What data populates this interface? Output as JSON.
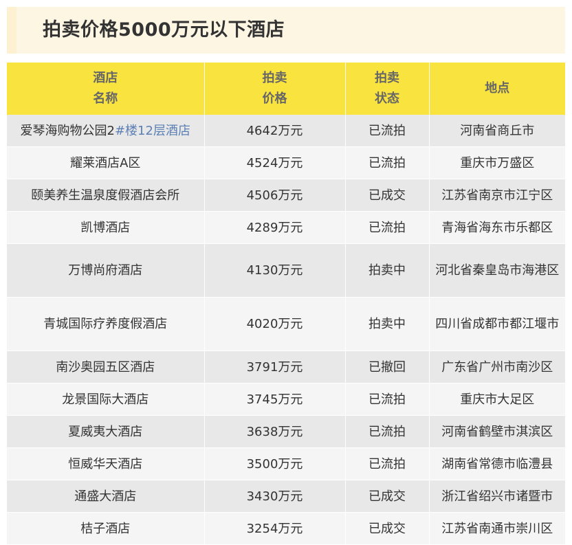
{
  "page": {
    "title": "拍卖价格5000万元以下酒店"
  },
  "table": {
    "headers": {
      "name": [
        "酒店",
        "名称"
      ],
      "price": [
        "拍卖",
        "价格"
      ],
      "status": [
        "拍卖",
        "状态"
      ],
      "location": "地点"
    },
    "rows": [
      {
        "name_plain": "爱琴海购物公园2",
        "name_link": "#楼12层酒店",
        "price": "4642万元",
        "status": "已流拍",
        "location": "河南省商丘市"
      },
      {
        "name_plain": "耀莱酒店A区",
        "name_link": "",
        "price": "4524万元",
        "status": "已流拍",
        "location": "重庆市万盛区"
      },
      {
        "name_plain": "颐美养生温泉度假酒店会所",
        "name_link": "",
        "price": "4506万元",
        "status": "已成交",
        "location": "江苏省南京市江宁区"
      },
      {
        "name_plain": "凯博酒店",
        "name_link": "",
        "price": "4289万元",
        "status": "已流拍",
        "location": "青海省海东市乐都区"
      },
      {
        "name_plain": "万博尚府酒店",
        "name_link": "",
        "price": "4130万元",
        "status": "拍卖中",
        "location": "河北省秦皇岛市海港区"
      },
      {
        "name_plain": "青城国际疗养度假酒店",
        "name_link": "",
        "price": "4020万元",
        "status": "拍卖中",
        "location": "四川省成都市都江堰市"
      },
      {
        "name_plain": "南沙奥园五区酒店",
        "name_link": "",
        "price": "3791万元",
        "status": "已撤回",
        "location": "广东省广州市南沙区"
      },
      {
        "name_plain": "龙景国际大酒店",
        "name_link": "",
        "price": "3745万元",
        "status": "已流拍",
        "location": "重庆市大足区"
      },
      {
        "name_plain": "夏威夷大酒店",
        "name_link": "",
        "price": "3638万元",
        "status": "已流拍",
        "location": "河南省鹤壁市淇滨区"
      },
      {
        "name_plain": "恒威华天酒店",
        "name_link": "",
        "price": "3500万元",
        "status": "已流拍",
        "location": "湖南省常德市临澧县"
      },
      {
        "name_plain": "通盛大酒店",
        "name_link": "",
        "price": "3430万元",
        "status": "已成交",
        "location": "浙江省绍兴市诸暨市"
      },
      {
        "name_plain": "桔子酒店",
        "name_link": "",
        "price": "3254万元",
        "status": "已成交",
        "location": "江苏省南通市崇川区"
      }
    ]
  },
  "colors": {
    "header_bg": "#f9e33f",
    "title_bg": "#fdf6e3",
    "row_odd": "#e8e8e8",
    "row_even": "#f5f5f5",
    "link": "#5b7fb5"
  }
}
